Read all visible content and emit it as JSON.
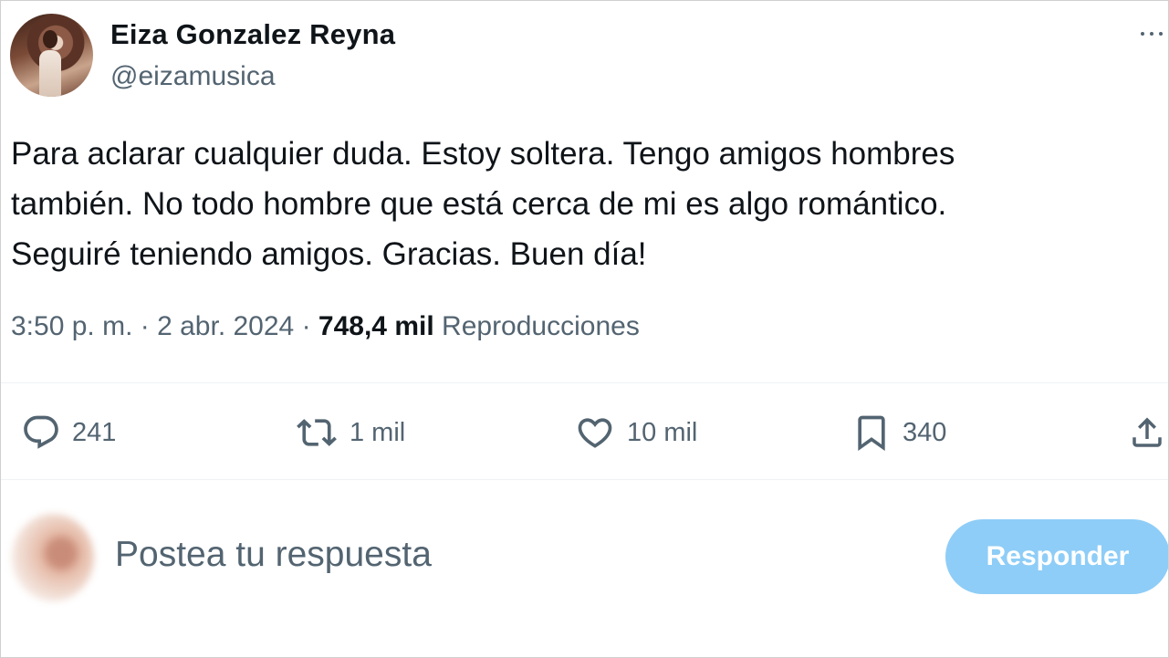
{
  "author": {
    "display_name": "Eiza Gonzalez Reyna",
    "handle": "@eizamusica"
  },
  "more_icon": "more-horizontal-icon",
  "tweet": {
    "lines": [
      "Para aclarar cualquier duda. Estoy soltera. Tengo amigos hombres",
      "también. No todo hombre que está cerca de mi es algo romántico.",
      "Seguiré teniendo amigos. Gracias. Buen día!"
    ]
  },
  "meta": {
    "time": "3:50 p. m.",
    "separator": "·",
    "date": "2 abr. 2024",
    "views_count": "748,4 mil",
    "views_label": "Reproducciones"
  },
  "actions": {
    "replies": {
      "icon": "reply-icon",
      "count": "241"
    },
    "reposts": {
      "icon": "repost-icon",
      "count": "1 mil"
    },
    "likes": {
      "icon": "heart-icon",
      "count": "10 mil"
    },
    "bookmarks": {
      "icon": "bookmark-icon",
      "count": "340"
    },
    "share": {
      "icon": "share-icon"
    }
  },
  "reply_box": {
    "placeholder": "Postea tu respuesta",
    "button_label": "Responder",
    "button_color": "#8ecdf7"
  },
  "colors": {
    "text_primary": "#0f1419",
    "text_secondary": "#536471",
    "divider": "#eff3f4"
  }
}
